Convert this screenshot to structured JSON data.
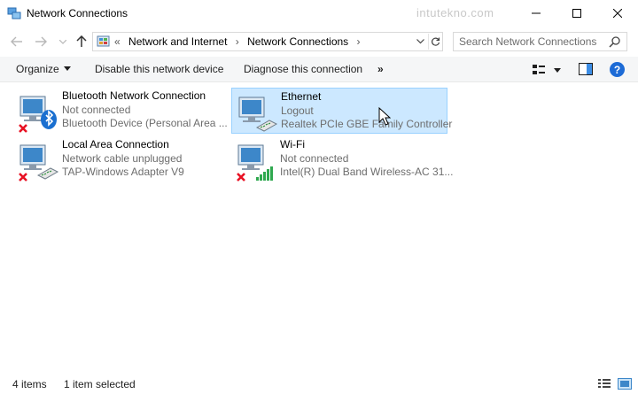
{
  "window": {
    "title": "Network Connections",
    "watermark": "intutekno.com",
    "icons": {
      "app": "network-connections-icon",
      "minimize": "minimize-icon",
      "maximize": "maximize-icon",
      "close": "close-icon"
    }
  },
  "navigation": {
    "breadcrumb_prefix": "«",
    "breadcrumbs": [
      "Network and Internet",
      "Network Connections"
    ],
    "breadcrumb_separator": "›",
    "search_placeholder": "Search Network Connections"
  },
  "commands": {
    "organize": "Organize",
    "disable": "Disable this network device",
    "diagnose": "Diagnose this connection",
    "more": "»",
    "help": "?"
  },
  "connections": [
    {
      "name": "Bluetooth Network Connection",
      "status": "Not connected",
      "device": "Bluetooth Device (Personal Area ...",
      "icon": "bluetooth-adapter-icon",
      "disconnected": true,
      "selected": false
    },
    {
      "name": "Ethernet",
      "status": "Logout",
      "device": "Realtek PCIe GBE Family Controller",
      "icon": "ethernet-adapter-icon",
      "disconnected": false,
      "selected": true
    },
    {
      "name": "Local Area Connection",
      "status": "Network cable unplugged",
      "device": "TAP-Windows Adapter V9",
      "icon": "ethernet-adapter-icon",
      "disconnected": true,
      "selected": false
    },
    {
      "name": "Wi-Fi",
      "status": "Not connected",
      "device": "Intel(R) Dual Band Wireless-AC 31...",
      "icon": "wifi-adapter-icon",
      "disconnected": true,
      "selected": false
    }
  ],
  "status": {
    "item_count": "4 items",
    "selected": "1 item selected"
  },
  "colors": {
    "selection_bg": "#cce8ff",
    "selection_border": "#99d1ff",
    "error_red": "#e81123",
    "accent_blue": "#1d6bd6",
    "wifi_green": "#2fa84f"
  }
}
